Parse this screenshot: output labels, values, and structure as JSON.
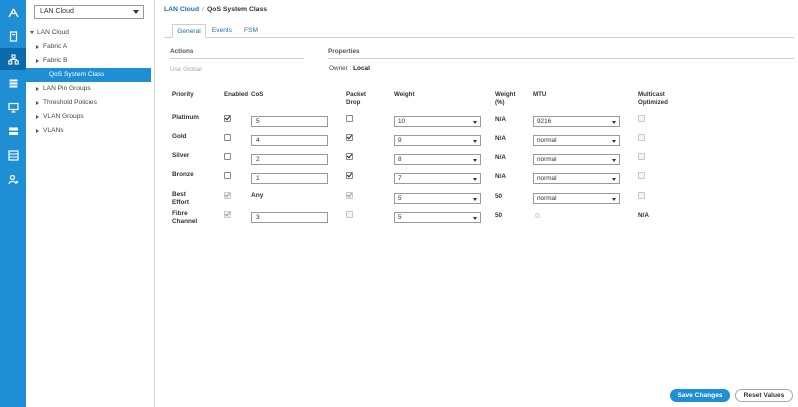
{
  "nav": {
    "selector_value": "LAN Cloud",
    "tree": [
      {
        "label": "LAN Cloud",
        "level": 0,
        "arrow": "down",
        "selected": false
      },
      {
        "label": "Fabric A",
        "level": 1,
        "arrow": "right",
        "selected": false
      },
      {
        "label": "Fabric B",
        "level": 1,
        "arrow": "right",
        "selected": false
      },
      {
        "label": "QoS System Class",
        "level": 2,
        "arrow": "",
        "selected": true
      },
      {
        "label": "LAN Pin Groups",
        "level": 1,
        "arrow": "right",
        "selected": false
      },
      {
        "label": "Threshold Policies",
        "level": 1,
        "arrow": "right",
        "selected": false
      },
      {
        "label": "VLAN Groups",
        "level": 1,
        "arrow": "right",
        "selected": false
      },
      {
        "label": "VLANs",
        "level": 1,
        "arrow": "right",
        "selected": false
      }
    ]
  },
  "rail": {
    "icons": [
      "network-icon",
      "server-icon",
      "lan-icon",
      "storage-icon",
      "vm-icon",
      "chassis-icon",
      "admin-icon",
      "user-icon"
    ],
    "active_index": 2
  },
  "breadcrumb": {
    "parent": "LAN Cloud",
    "separator": "/",
    "current": "QoS System Class"
  },
  "tabs": [
    "General",
    "Events",
    "FSM"
  ],
  "actions": {
    "title": "Actions",
    "use_global": "Use Global"
  },
  "properties": {
    "title": "Properties",
    "owner_label": "Owner :",
    "owner_value": "Local"
  },
  "table": {
    "headers": {
      "priority": "Priority",
      "enabled": "Enabled",
      "cos": "CoS",
      "packet_drop": [
        "Packet",
        "Drop"
      ],
      "weight": "Weight",
      "weight_pct": [
        "Weight",
        "(%)"
      ],
      "mtu": "MTU",
      "multicast": [
        "Multicast",
        "Optimized"
      ]
    },
    "rows": [
      {
        "priority": [
          "Platinum"
        ],
        "enabled": true,
        "enabled_disabled": false,
        "cos": "5",
        "cos_static": false,
        "packet_drop": false,
        "packet_drop_disabled": false,
        "weight": "10",
        "weight_pct": "N/A",
        "mtu": "9216",
        "mtu_radio": false,
        "multicast": false,
        "multicast_na": false
      },
      {
        "priority": [
          "Gold"
        ],
        "enabled": false,
        "enabled_disabled": false,
        "cos": "4",
        "cos_static": false,
        "packet_drop": true,
        "packet_drop_disabled": false,
        "weight": "9",
        "weight_pct": "N/A",
        "mtu": "normal",
        "mtu_radio": false,
        "multicast": false,
        "multicast_na": false
      },
      {
        "priority": [
          "Silver"
        ],
        "enabled": false,
        "enabled_disabled": false,
        "cos": "2",
        "cos_static": false,
        "packet_drop": true,
        "packet_drop_disabled": false,
        "weight": "8",
        "weight_pct": "N/A",
        "mtu": "normal",
        "mtu_radio": false,
        "multicast": false,
        "multicast_na": false
      },
      {
        "priority": [
          "Bronze"
        ],
        "enabled": false,
        "enabled_disabled": false,
        "cos": "1",
        "cos_static": false,
        "packet_drop": true,
        "packet_drop_disabled": false,
        "weight": "7",
        "weight_pct": "N/A",
        "mtu": "normal",
        "mtu_radio": false,
        "multicast": false,
        "multicast_na": false
      },
      {
        "priority": [
          "Best",
          "Effort"
        ],
        "enabled": true,
        "enabled_disabled": true,
        "cos": "Any",
        "cos_static": true,
        "packet_drop": true,
        "packet_drop_disabled": true,
        "weight": "5",
        "weight_pct": "50",
        "mtu": "normal",
        "mtu_radio": false,
        "multicast": false,
        "multicast_na": false
      },
      {
        "priority": [
          "Fibre",
          "Channel"
        ],
        "enabled": true,
        "enabled_disabled": true,
        "cos": "3",
        "cos_static": false,
        "packet_drop": false,
        "packet_drop_disabled": true,
        "weight": "5",
        "weight_pct": "50",
        "mtu": "fc",
        "mtu_radio": true,
        "multicast": false,
        "multicast_na": true,
        "multicast_text": "N/A"
      }
    ]
  },
  "buttons": {
    "save": "Save Changes",
    "reset": "Reset Values"
  },
  "colors": {
    "accent": "#1e8fd5",
    "accent_dark": "#0a6aab",
    "link": "#1e6fb0"
  }
}
